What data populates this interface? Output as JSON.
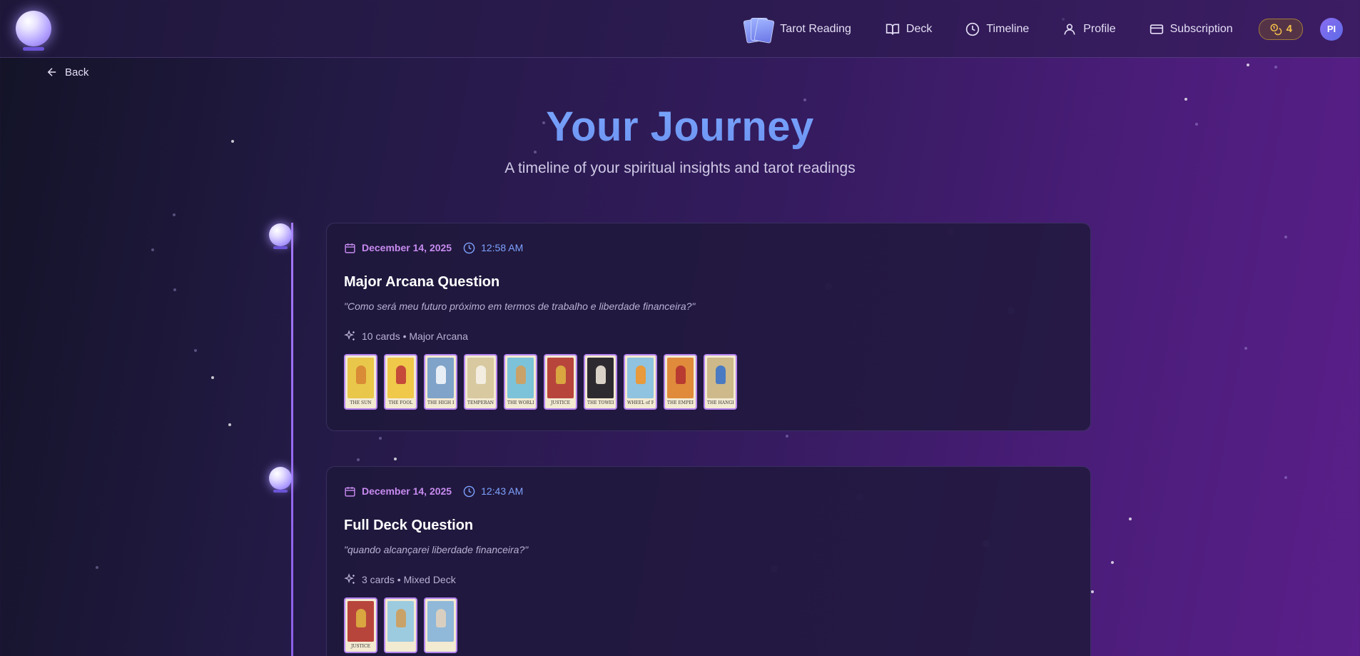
{
  "header": {
    "nav": [
      {
        "id": "tarot-reading",
        "label": "Tarot Reading"
      },
      {
        "id": "deck",
        "label": "Deck"
      },
      {
        "id": "timeline",
        "label": "Timeline"
      },
      {
        "id": "profile",
        "label": "Profile"
      },
      {
        "id": "subscription",
        "label": "Subscription"
      }
    ],
    "coins": "4",
    "avatar_initials": "PI"
  },
  "back_label": "Back",
  "page": {
    "title": "Your Journey",
    "subtitle": "A timeline of your spiritual insights and tarot readings"
  },
  "entries": [
    {
      "date": "December 14, 2025",
      "time": "12:58 AM",
      "title": "Major Arcana Question",
      "question": "\"Como será meu futuro próximo em termos de trabalho e liberdade financeira?\"",
      "info": "10 cards • Major Arcana",
      "cards": [
        {
          "name": "THE SUN",
          "art": "#e9c74a",
          "fig": "#d98b36"
        },
        {
          "name": "THE FOOL",
          "art": "#f0c84a",
          "fig": "#c54a3a"
        },
        {
          "name": "THE HIGH PRIESTESS",
          "art": "#7fa3c9",
          "fig": "#e8eef5"
        },
        {
          "name": "TEMPERANCE",
          "art": "#d8c9a0",
          "fig": "#f2ede0"
        },
        {
          "name": "THE WORLD",
          "art": "#7cc3d9",
          "fig": "#c9a26a"
        },
        {
          "name": "JUSTICE",
          "art": "#b8453c",
          "fig": "#d9a640"
        },
        {
          "name": "THE TOWER",
          "art": "#2e2b30",
          "fig": "#d9d2c6"
        },
        {
          "name": "WHEEL of FORTUNE",
          "art": "#8fc3e0",
          "fig": "#e89a3c"
        },
        {
          "name": "THE EMPEROR",
          "art": "#e08a3c",
          "fig": "#b83a30"
        },
        {
          "name": "THE HANGED MAN",
          "art": "#cdb98a",
          "fig": "#4a7bc2"
        }
      ]
    },
    {
      "date": "December 14, 2025",
      "time": "12:43 AM",
      "title": "Full Deck Question",
      "question": "\"quando alcançarei liberdade financeira?\"",
      "info": "3 cards • Mixed Deck",
      "cards": [
        {
          "name": "JUSTICE",
          "art": "#b8453c",
          "fig": "#d9a640"
        },
        {
          "name": "",
          "art": "#9ccbe0",
          "fig": "#c9a26a"
        },
        {
          "name": "",
          "art": "#8fb8d9",
          "fig": "#d8cfc0"
        }
      ]
    }
  ]
}
